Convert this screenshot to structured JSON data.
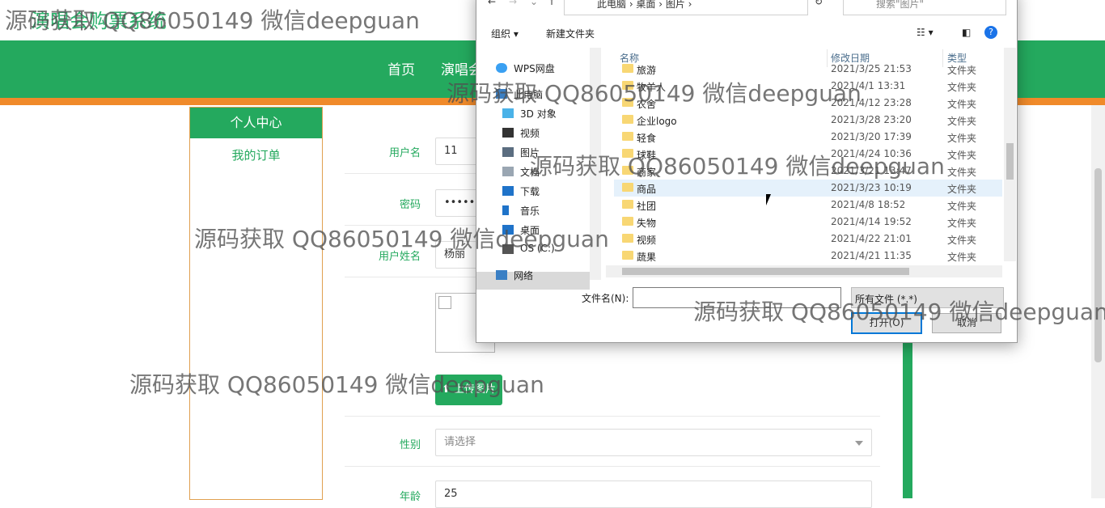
{
  "site": {
    "title": "演唱会购票系统",
    "nav": [
      "首页",
      "演唱会"
    ]
  },
  "sidebar": {
    "header": "个人中心",
    "items": [
      "我的订单"
    ]
  },
  "form": {
    "username_label": "用户名",
    "username_value": "11",
    "password_label": "密码",
    "password_value": "••••••",
    "realname_label": "用户姓名",
    "realname_value": "杨丽",
    "upload_label": "上传图片",
    "gender_label": "性别",
    "gender_placeholder": "请选择",
    "age_label": "年龄",
    "age_value": "25"
  },
  "dialog": {
    "address": "此电脑 › 桌面 › 图片 ›",
    "search_placeholder": "搜索\"图片\"",
    "toolbar": {
      "organize": "组织 ▾",
      "new_folder": "新建文件夹"
    },
    "nav_items": [
      "WPS网盘",
      "此电脑",
      "3D 对象",
      "视频",
      "图片",
      "文档",
      "下载",
      "音乐",
      "桌面",
      "OS (C:)",
      "网络"
    ],
    "columns": {
      "name": "名称",
      "date": "修改日期",
      "type": "类型"
    },
    "files": [
      {
        "name": "旅游",
        "date": "2021/3/25 21:53",
        "type": "文件夹"
      },
      {
        "name": "牧羊人",
        "date": "2021/4/1 13:31",
        "type": "文件夹"
      },
      {
        "name": "农舍",
        "date": "2021/4/12 23:28",
        "type": "文件夹"
      },
      {
        "name": "企业logo",
        "date": "2021/3/28 23:20",
        "type": "文件夹"
      },
      {
        "name": "轻食",
        "date": "2021/3/20 17:39",
        "type": "文件夹"
      },
      {
        "name": "球鞋",
        "date": "2021/4/24 10:36",
        "type": "文件夹"
      },
      {
        "name": "商家",
        "date": "2021/3/21 13:47",
        "type": "文件夹"
      },
      {
        "name": "商品",
        "date": "2021/3/23 10:19",
        "type": "文件夹"
      },
      {
        "name": "社团",
        "date": "2021/4/8 18:52",
        "type": "文件夹"
      },
      {
        "name": "失物",
        "date": "2021/4/14 19:52",
        "type": "文件夹"
      },
      {
        "name": "视频",
        "date": "2021/4/22 21:01",
        "type": "文件夹"
      },
      {
        "name": "蔬果",
        "date": "2021/4/21 11:35",
        "type": "文件夹"
      }
    ],
    "filename_label": "文件名(N):",
    "filename_value": "",
    "filter_value": "所有文件 (*.*)",
    "open_button": "打开(O)",
    "cancel_button": "取消"
  },
  "watermark": "源码获取 QQ86050149 微信deepguan"
}
